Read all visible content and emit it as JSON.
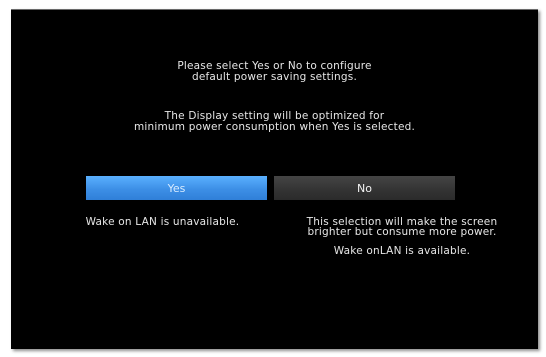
{
  "prompt": {
    "line1": "Please select Yes or No to configure",
    "line2": "default power saving settings.",
    "line3": "The Display setting will be optimized for",
    "line4": "minimum power consumption when Yes is selected."
  },
  "buttons": {
    "yes_label": "Yes",
    "no_label": "No"
  },
  "yes_note": "Wake on LAN is unavailable.",
  "no_note": {
    "line1": "This selection will make the screen",
    "line2": "brighter but consume more power.",
    "line3": "Wake onLAN is available."
  },
  "colors": {
    "background": "#000000",
    "selected_button": "#3d8fe6",
    "unselected_button": "#333333",
    "text": "#e6e6e6"
  }
}
